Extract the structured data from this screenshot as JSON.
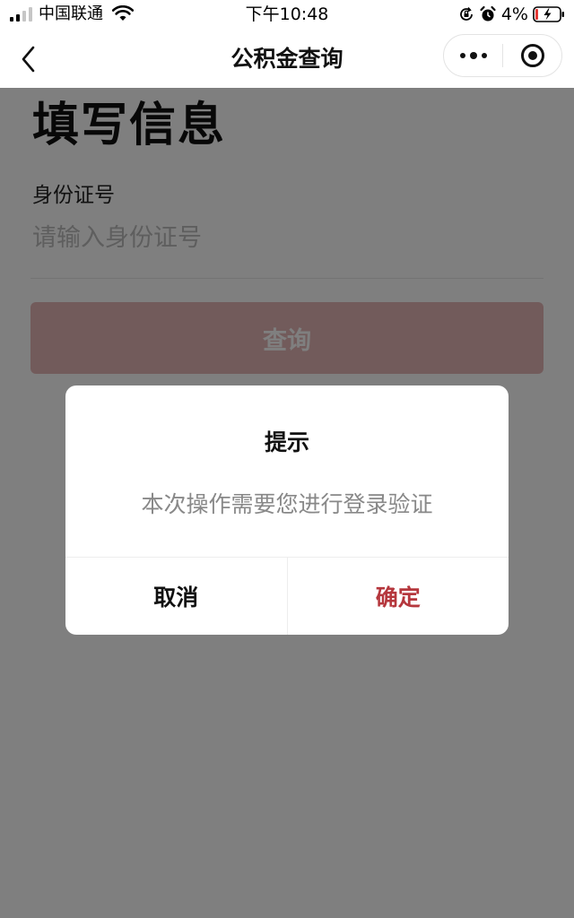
{
  "status_bar": {
    "carrier": "中国联通",
    "time": "下午10:48",
    "battery": "4%"
  },
  "nav": {
    "title": "公积金查询"
  },
  "form": {
    "heading": "填写信息",
    "id_label": "身份证号",
    "id_placeholder": "请输入身份证号",
    "id_value": "",
    "submit_label": "查询"
  },
  "dialog": {
    "title": "提示",
    "message": "本次操作需要您进行登录验证",
    "cancel_label": "取消",
    "confirm_label": "确定"
  },
  "colors": {
    "accent": "#b5373d",
    "button_disabled": "#e5b7b7",
    "overlay": "rgba(0,0,0,0.5)"
  },
  "icons": {
    "back": "chevron-left-icon",
    "more": "more-dots-icon",
    "close": "target-circle-icon"
  }
}
